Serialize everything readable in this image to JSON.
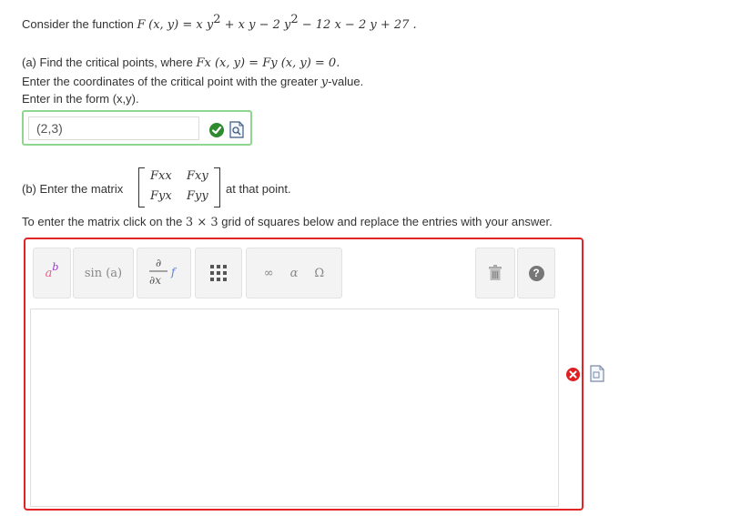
{
  "question": {
    "intro": "Consider the function ",
    "fname": "F",
    "fargs": "(x, y) = ",
    "expr_parts": [
      "x y",
      "2",
      " + x y − 2 y",
      "2",
      " − 12 x − 2 y + 27 ."
    ],
    "part_a_prefix": "(a) Find the critical points, where ",
    "part_a_math": "Fx (x, y) = Fy (x, y) = 0.",
    "part_a_line2_pre": "Enter the coordinates of the critical point with the greater ",
    "part_a_line2_var": "y",
    "part_a_line2_post": "-value.",
    "part_a_line3": "Enter in the form (x,y).",
    "part_b_prefix": "(b) Enter the matrix",
    "part_b_suffix": "at that point.",
    "matrix_cells": [
      "Fxx",
      "Fxy",
      "Fyx",
      "Fyy"
    ],
    "part_b_line2_pre": "To enter the matrix click on the ",
    "part_b_line2_math": "3 × 3",
    "part_b_line2_post": " grid of squares below and replace the entries with your answer."
  },
  "answer_a": {
    "value": "(2,3)",
    "status": "correct"
  },
  "toolbar": {
    "superscript_label": "a b",
    "sin_label": "sin (a)",
    "deriv_label": "∂ / ∂x f",
    "symbols": [
      "∞",
      "α",
      "Ω"
    ],
    "help_label": "?"
  },
  "answer_b": {
    "value": "",
    "status": "incorrect"
  },
  "colors": {
    "correct": "#2e8b2e",
    "correct_border": "#8fd68f",
    "incorrect": "#e32424",
    "superscript_accent": "#9b30c8"
  },
  "icons": [
    "check-icon",
    "preview-icon",
    "superscript-icon",
    "derivative-icon",
    "matrix-grid-icon",
    "delete-icon",
    "help-icon",
    "error-icon"
  ]
}
